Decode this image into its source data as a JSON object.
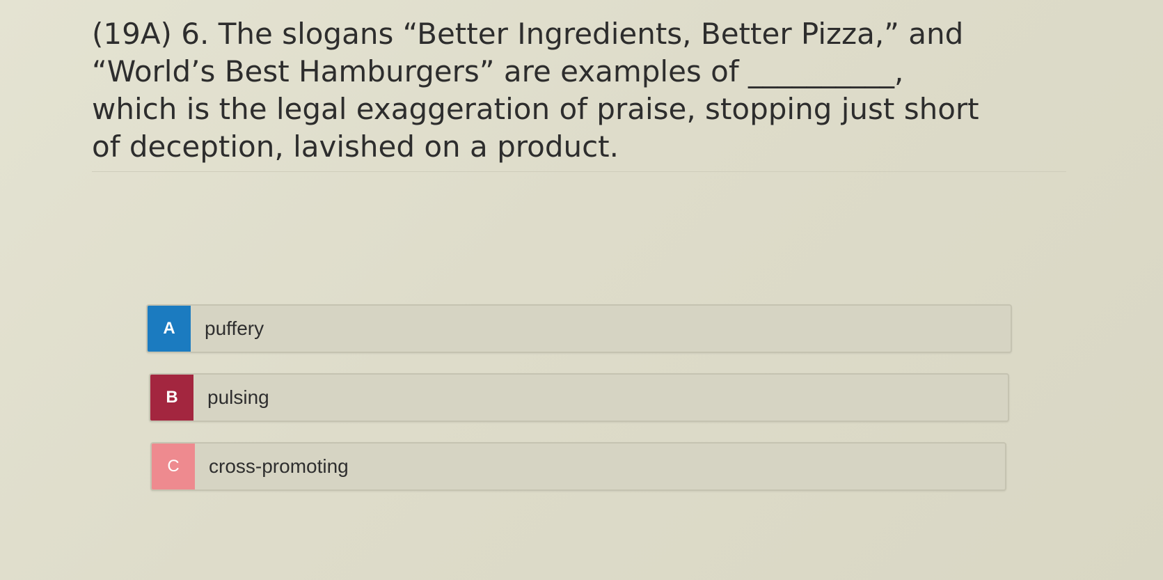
{
  "question": {
    "lines": [
      "(19A) 6. The slogans “Better Ingredients, Better Pizza,” and",
      "“World’s Best Hamburgers” are examples of __________,",
      "which is the legal exaggeration of praise, stopping just short",
      "of deception, lavished on a product."
    ]
  },
  "options": [
    {
      "letter": "A",
      "text": "puffery",
      "color": "#1b7bc0"
    },
    {
      "letter": "B",
      "text": "pulsing",
      "color": "#a3263f"
    },
    {
      "letter": "C",
      "text": "cross-promoting",
      "color": "#ee8a8f"
    }
  ]
}
